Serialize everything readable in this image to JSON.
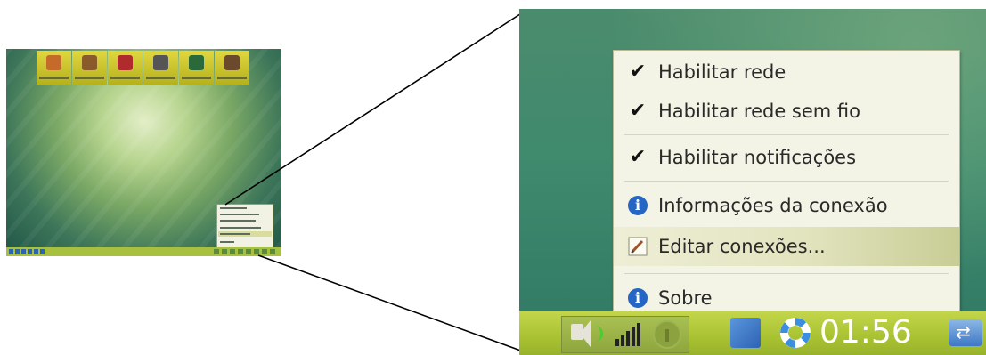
{
  "menu": {
    "items": [
      {
        "label": "Habilitar rede",
        "icon": "check-icon",
        "checked": true
      },
      {
        "label": "Habilitar rede sem fio",
        "icon": "check-icon",
        "checked": true
      },
      {
        "label": "Habilitar notificações",
        "icon": "check-icon",
        "checked": true
      },
      {
        "label": "Informações da conexão",
        "icon": "info-icon"
      },
      {
        "label": "Editar conexões...",
        "icon": "pencil-icon",
        "highlighted": true
      },
      {
        "label": "Sobre",
        "icon": "info-icon"
      }
    ]
  },
  "taskbar": {
    "clock": "01:56",
    "tray_icons": [
      "speaker-icon",
      "signal-bars-icon",
      "info-disabled-icon",
      "cube-icon",
      "lifebuoy-icon",
      "usb-icon"
    ]
  },
  "colors": {
    "taskbar": "#a9c232",
    "menu_bg": "#f3f3e6",
    "highlight": "#c8cd95",
    "info_blue": "#2565c4"
  }
}
